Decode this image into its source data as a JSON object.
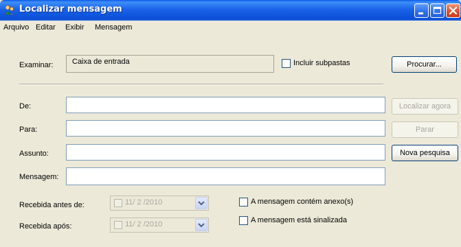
{
  "window": {
    "title": "Localizar mensagem"
  },
  "menu": [
    "Arquivo",
    "Editar",
    "Exibir",
    "Mensagem"
  ],
  "look_in": {
    "label": "Examinar:",
    "value": "Caixa de entrada",
    "include_subfolders_label": "Incluir subpastas",
    "browse_label": "Procurar..."
  },
  "fields": {
    "from_label": "De:",
    "to_label": "Para:",
    "subject_label": "Assunto:",
    "message_label": "Mensagem:",
    "from_value": "",
    "to_value": "",
    "subject_value": "",
    "message_value": ""
  },
  "buttons": {
    "find_now": "Localizar agora",
    "stop": "Parar",
    "new_search": "Nova pesquisa"
  },
  "dates": {
    "received_before_label": "Recebida antes de:",
    "received_before_value": "11/ 2 /2010",
    "received_after_label": "Recebida após:",
    "received_after_value": "11/ 2 /2010"
  },
  "options": {
    "has_attachment": "A mensagem contém anexo(s)",
    "is_flagged": "A mensagem está sinalizada"
  },
  "colors": {
    "titlebar": "#0b4fd6",
    "window_bg": "#ece9d8",
    "field_border": "#7f9db9",
    "close_button": "#d8502c"
  },
  "icons": {
    "app": "find-people-icon",
    "minimize": "minimize-icon",
    "maximize": "maximize-icon",
    "close": "close-icon",
    "dropdown": "chevron-down-icon"
  }
}
